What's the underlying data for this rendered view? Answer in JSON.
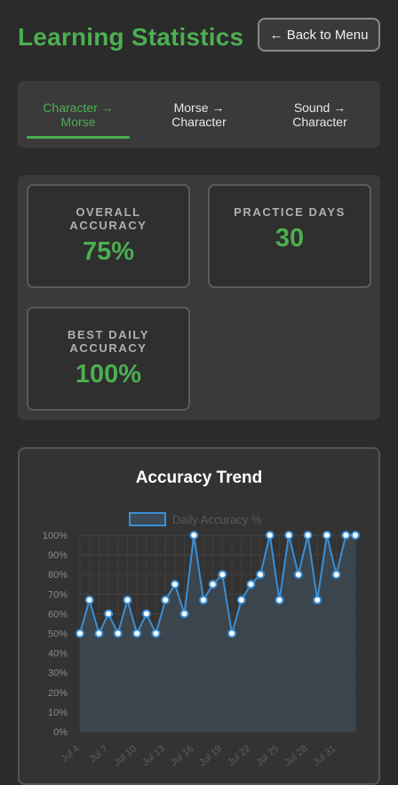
{
  "header": {
    "title": "Learning Statistics",
    "back_label": "← Back to Menu"
  },
  "tabs": [
    {
      "label": "Character →\nMorse",
      "active": true
    },
    {
      "label": "Morse →\nCharacter",
      "active": false
    },
    {
      "label": "Sound →\nCharacter",
      "active": false
    }
  ],
  "stats": {
    "overall_label": "OVERALL\nACCURACY",
    "overall_value": "75%",
    "days_label": "PRACTICE DAYS",
    "days_value": "30",
    "best_label": "BEST DAILY\nACCURACY",
    "best_value": "100%"
  },
  "chart_data": {
    "type": "line",
    "title": "Accuracy Trend",
    "series": [
      {
        "name": "Daily Accuracy %",
        "values": [
          50,
          67,
          50,
          60,
          50,
          67,
          50,
          60,
          50,
          67,
          75,
          60,
          100,
          67,
          75,
          80,
          50,
          67,
          75,
          80,
          100,
          67,
          100,
          80,
          100,
          67,
          100,
          80,
          100,
          100
        ]
      }
    ],
    "x_tick_labels": [
      "Jul 4",
      "Jul 7",
      "Jul 10",
      "Jul 13",
      "Jul 16",
      "Jul 19",
      "Jul 22",
      "Jul 25",
      "Jul 28",
      "Jul 31"
    ],
    "y_tick_labels": [
      "0%",
      "10%",
      "20%",
      "30%",
      "40%",
      "50%",
      "60%",
      "70%",
      "80%",
      "90%",
      "100%"
    ],
    "ylim": [
      0,
      100
    ],
    "grid": true,
    "legend": "top",
    "colors": {
      "line": "#3a8fd6",
      "fill": "#3d4a55",
      "point_fill": "#ffffff"
    }
  }
}
